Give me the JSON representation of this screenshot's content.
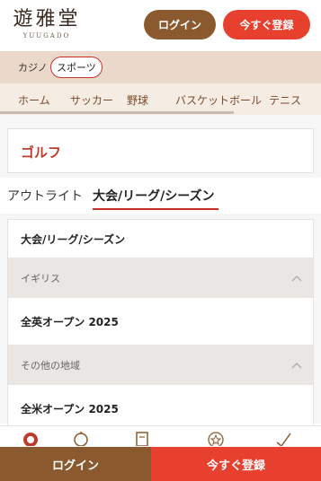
{
  "header": {
    "logo_main": "遊雅堂",
    "logo_sub": "YUUGADO",
    "login_label": "ログイン",
    "register_label": "今すぐ登録"
  },
  "categories": {
    "casino": "カジノ",
    "sports": "スポーツ"
  },
  "sport_nav": [
    "ホーム",
    "サッカー",
    "野球",
    "バスケットボール",
    "テニス"
  ],
  "page": {
    "title": "ゴルフ"
  },
  "tabs": {
    "outright": "アウトライト",
    "league": "大会/リーグ/シーズン"
  },
  "list": {
    "header": "大会/リーグ/シーズン",
    "groups": [
      {
        "name": "イギリス",
        "items": [
          "全英オープン 2025"
        ]
      },
      {
        "name": "その他の地域",
        "items": [
          "全米オープン 2025"
        ]
      }
    ]
  },
  "bottom_bar": {
    "login_label": "ログイン",
    "register_label": "今すぐ登録"
  },
  "colors": {
    "brand_brown": "#8a5a2e",
    "brand_red": "#e8402e",
    "accent_red": "#c0392b"
  }
}
